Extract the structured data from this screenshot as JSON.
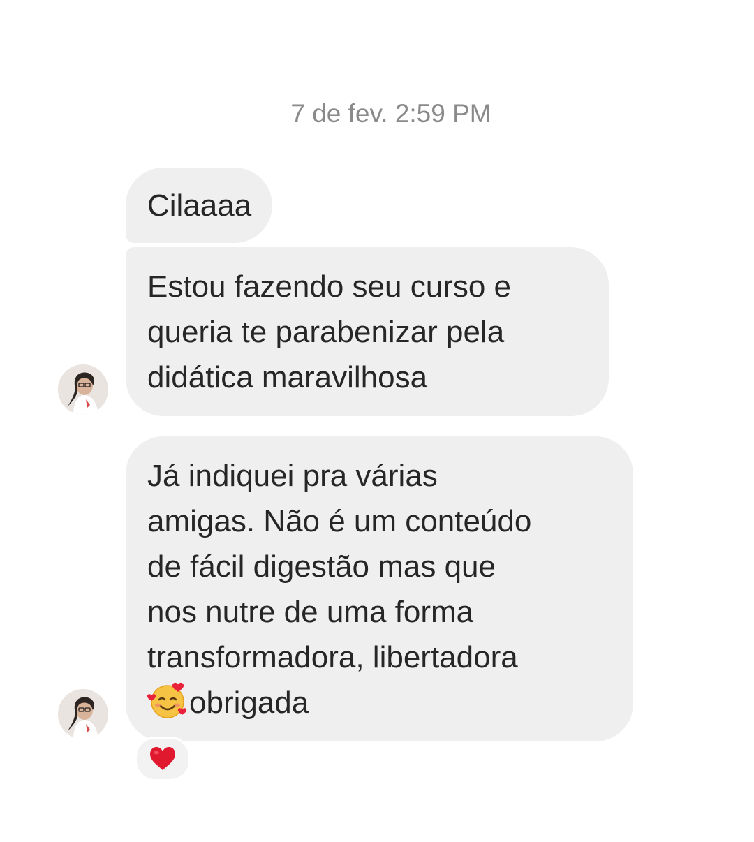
{
  "chat": {
    "timestamp": "7 de fev. 2:59 PM",
    "messages": [
      {
        "lines": [
          "Cilaaaa"
        ]
      },
      {
        "lines": [
          "Estou fazendo seu curso e",
          "queria te parabenizar pela",
          "didática maravilhosa"
        ]
      },
      {
        "lines": [
          "Já indiquei pra várias",
          "amigas. Não é um conteúdo",
          "de fácil digestão mas que",
          "nos nutre de uma forma",
          "transformadora, libertadora"
        ],
        "last_line_text": "obrigada",
        "last_line_emoji": "smiling-face-with-hearts-icon"
      }
    ],
    "reaction": "heart-icon",
    "colors": {
      "bubble": "#efefef",
      "text": "#262626",
      "timestamp": "#8a8a8a",
      "reaction_heart": "#e0192e"
    }
  }
}
